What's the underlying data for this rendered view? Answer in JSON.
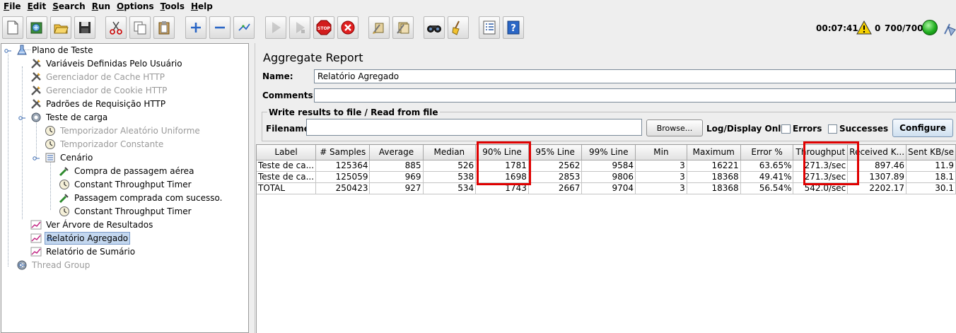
{
  "menu": [
    {
      "ul": "F",
      "rest": "ile"
    },
    {
      "ul": "E",
      "rest": "dit"
    },
    {
      "ul": "S",
      "rest": "earch"
    },
    {
      "ul": "R",
      "rest": "un"
    },
    {
      "ul": "O",
      "rest": "ptions"
    },
    {
      "ul": "T",
      "rest": "ools"
    },
    {
      "ul": "H",
      "rest": "elp"
    }
  ],
  "toolbar": {
    "buttons": [
      "new-icon",
      "templates-icon",
      "open-icon",
      "save-icon",
      "cut-icon",
      "copy-icon",
      "paste-icon",
      "expand-icon",
      "collapse-icon",
      "toggle-icon",
      "start-icon",
      "start-no-pauses-icon",
      "stop-icon",
      "shutdown-icon",
      "clear-icon",
      "clear-all-icon",
      "search-icon",
      "reset-search-icon",
      "function-helper-icon",
      "help-icon"
    ],
    "elapsed_time": "00:07:41",
    "warning_count": "0",
    "threads": "700/700",
    "status_color": "#1fae1f"
  },
  "tree": {
    "nodes": [
      {
        "label": "Plano de Teste",
        "icon": "test-plan-icon",
        "enabled": true,
        "selected": false
      },
      {
        "label": "Variáveis Definidas Pelo Usuário",
        "icon": "config-element-icon",
        "enabled": true,
        "selected": false
      },
      {
        "label": "Gerenciador de Cache HTTP",
        "icon": "config-element-icon",
        "enabled": false,
        "selected": false
      },
      {
        "label": "Gerenciador de Cookie HTTP",
        "icon": "config-element-icon",
        "enabled": false,
        "selected": false
      },
      {
        "label": "Padrões de Requisição HTTP",
        "icon": "config-element-icon",
        "enabled": true,
        "selected": false
      },
      {
        "label": "Teste de carga",
        "icon": "thread-group-icon",
        "enabled": true,
        "selected": false
      },
      {
        "label": "Temporizador Aleatório Uniforme",
        "icon": "timer-icon",
        "enabled": false,
        "selected": false
      },
      {
        "label": "Temporizador Constante",
        "icon": "timer-icon",
        "enabled": false,
        "selected": false
      },
      {
        "label": "Cenário",
        "icon": "controller-icon",
        "enabled": true,
        "selected": false
      },
      {
        "label": "Compra de passagem aérea",
        "icon": "sampler-icon",
        "enabled": true,
        "selected": false
      },
      {
        "label": "Constant Throughput Timer",
        "icon": "timer-icon",
        "enabled": true,
        "selected": false
      },
      {
        "label": "Passagem comprada com sucesso.",
        "icon": "sampler-icon",
        "enabled": true,
        "selected": false
      },
      {
        "label": "Constant Throughput Timer",
        "icon": "timer-icon",
        "enabled": true,
        "selected": false
      },
      {
        "label": "Ver Árvore de Resultados",
        "icon": "listener-icon",
        "enabled": true,
        "selected": false
      },
      {
        "label": "Relatório Agregado",
        "icon": "listener-icon",
        "enabled": true,
        "selected": true
      },
      {
        "label": "Relatório de Sumário",
        "icon": "listener-icon",
        "enabled": true,
        "selected": false
      },
      {
        "label": "Thread Group",
        "icon": "thread-group-icon",
        "enabled": false,
        "selected": false
      }
    ]
  },
  "report": {
    "title": "Aggregate Report",
    "name_label": "Name:",
    "name_value": "Relatório Agregado",
    "comments_label": "Comments:",
    "comments_value": "",
    "file_group_title": "Write results to file / Read from file",
    "filename_label": "Filename",
    "filename_value": "",
    "browse_label": "Browse...",
    "log_display_label": "Log/Display Only:",
    "errors_label": "Errors",
    "successes_label": "Successes",
    "configure_label": "Configure",
    "columns": [
      "Label",
      "# Samples",
      "Average",
      "Median",
      "90% Line",
      "95% Line",
      "99% Line",
      "Min",
      "Maximum",
      "Error %",
      "Throughput",
      "Received K...",
      "Sent KB/se"
    ],
    "rows": [
      [
        "Teste de ca...",
        "125364",
        "885",
        "526",
        "1781",
        "2562",
        "9584",
        "3",
        "16221",
        "63.65%",
        "271.3/sec",
        "897.46",
        "11.9"
      ],
      [
        "Teste de ca...",
        "125059",
        "969",
        "538",
        "1698",
        "2853",
        "9806",
        "3",
        "18368",
        "49.41%",
        "271.3/sec",
        "1307.89",
        "18.1"
      ],
      [
        "TOTAL",
        "250423",
        "927",
        "534",
        "1743",
        "2667",
        "9704",
        "3",
        "18368",
        "56.54%",
        "542.0/sec",
        "2202.17",
        "30.1"
      ]
    ]
  }
}
